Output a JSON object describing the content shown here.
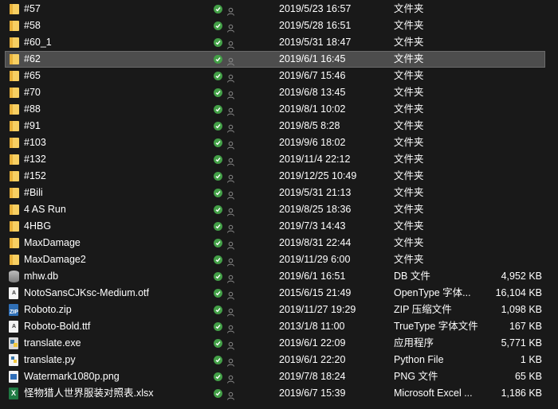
{
  "rows": [
    {
      "name": "#57",
      "date": "2019/5/23 16:57",
      "type": "文件夹",
      "size": "",
      "icon": "folder-icon"
    },
    {
      "name": "#58",
      "date": "2019/5/28 16:51",
      "type": "文件夹",
      "size": "",
      "icon": "folder-icon"
    },
    {
      "name": "#60_1",
      "date": "2019/5/31 18:47",
      "type": "文件夹",
      "size": "",
      "icon": "folder-icon"
    },
    {
      "name": "#62",
      "date": "2019/6/1 16:45",
      "type": "文件夹",
      "size": "",
      "icon": "folder-icon",
      "selected": true
    },
    {
      "name": "#65",
      "date": "2019/6/7 15:46",
      "type": "文件夹",
      "size": "",
      "icon": "folder-icon"
    },
    {
      "name": "#70",
      "date": "2019/6/8 13:45",
      "type": "文件夹",
      "size": "",
      "icon": "folder-icon"
    },
    {
      "name": "#88",
      "date": "2019/8/1 10:02",
      "type": "文件夹",
      "size": "",
      "icon": "folder-icon"
    },
    {
      "name": "#91",
      "date": "2019/8/5 8:28",
      "type": "文件夹",
      "size": "",
      "icon": "folder-icon"
    },
    {
      "name": "#103",
      "date": "2019/9/6 18:02",
      "type": "文件夹",
      "size": "",
      "icon": "folder-icon"
    },
    {
      "name": "#132",
      "date": "2019/11/4 22:12",
      "type": "文件夹",
      "size": "",
      "icon": "folder-icon"
    },
    {
      "name": "#152",
      "date": "2019/12/25 10:49",
      "type": "文件夹",
      "size": "",
      "icon": "folder-icon"
    },
    {
      "name": "#Bili",
      "date": "2019/5/31 21:13",
      "type": "文件夹",
      "size": "",
      "icon": "folder-icon"
    },
    {
      "name": "4 AS Run",
      "date": "2019/8/25 18:36",
      "type": "文件夹",
      "size": "",
      "icon": "folder-icon"
    },
    {
      "name": "4HBG",
      "date": "2019/7/3 14:43",
      "type": "文件夹",
      "size": "",
      "icon": "folder-icon"
    },
    {
      "name": "MaxDamage",
      "date": "2019/8/31 22:44",
      "type": "文件夹",
      "size": "",
      "icon": "folder-icon"
    },
    {
      "name": "MaxDamage2",
      "date": "2019/11/29 6:00",
      "type": "文件夹",
      "size": "",
      "icon": "folder-icon"
    },
    {
      "name": "mhw.db",
      "date": "2019/6/1 16:51",
      "type": "DB 文件",
      "size": "4,952 KB",
      "icon": "database-icon"
    },
    {
      "name": "NotoSansCJKsc-Medium.otf",
      "date": "2015/6/15 21:49",
      "type": "OpenType 字体...",
      "size": "16,104 KB",
      "icon": "font-file-icon"
    },
    {
      "name": "Roboto.zip",
      "date": "2019/11/27 19:29",
      "type": "ZIP 压缩文件",
      "size": "1,098 KB",
      "icon": "zip-file-icon"
    },
    {
      "name": "Roboto-Bold.ttf",
      "date": "2013/1/8 11:00",
      "type": "TrueType 字体文件",
      "size": "167 KB",
      "icon": "font-file-icon"
    },
    {
      "name": "translate.exe",
      "date": "2019/6/1 22:09",
      "type": "应用程序",
      "size": "5,771 KB",
      "icon": "python-exe-icon"
    },
    {
      "name": "translate.py",
      "date": "2019/6/1 22:20",
      "type": "Python File",
      "size": "1 KB",
      "icon": "python-file-icon"
    },
    {
      "name": "Watermark1080p.png",
      "date": "2019/7/8 18:24",
      "type": "PNG 文件",
      "size": "65 KB",
      "icon": "image-file-icon"
    },
    {
      "name": "怪物猎人世界服装对照表.xlsx",
      "date": "2019/6/7 15:39",
      "type": "Microsoft Excel ...",
      "size": "1,186 KB",
      "icon": "excel-file-icon"
    }
  ],
  "colors": {
    "background": "#191919",
    "selected_row": "#4d4d4d",
    "folder": "#f7cf62",
    "sync_check": "#43a047"
  }
}
